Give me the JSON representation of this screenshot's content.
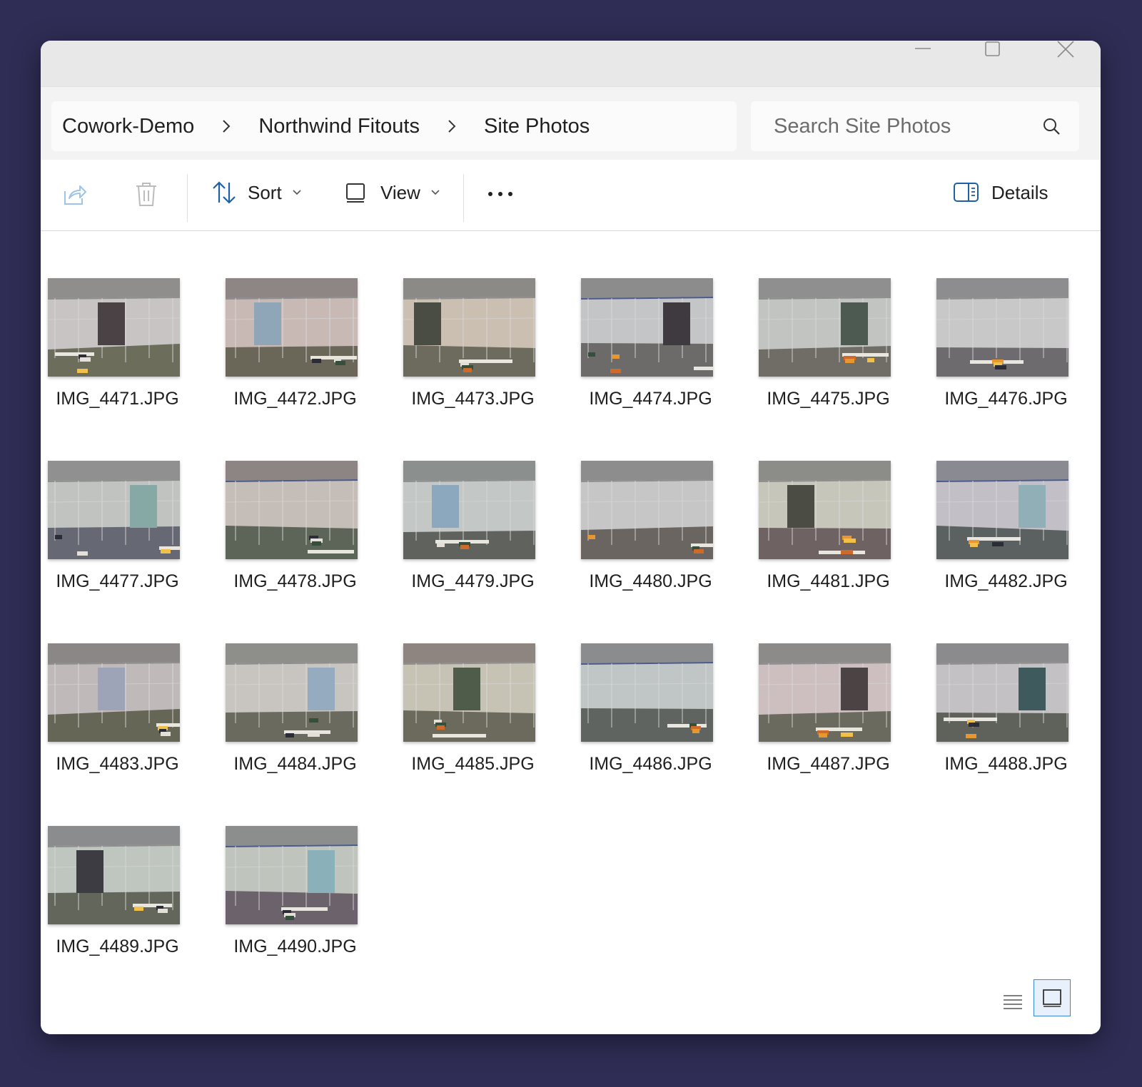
{
  "window": {
    "controls": [
      "minimize",
      "maximize",
      "close"
    ]
  },
  "breadcrumb": {
    "items": [
      "Cowork-Demo",
      "Northwind Fitouts",
      "Site Photos"
    ]
  },
  "search": {
    "placeholder": "Search Site Photos",
    "icon": "search-icon"
  },
  "toolbar": {
    "share_icon": "share-icon",
    "delete_icon": "trash-icon",
    "sort_label": "Sort",
    "view_label": "View",
    "more_icon": "more-icon",
    "details_label": "Details"
  },
  "files": [
    {
      "name": "IMG_4471.JPG",
      "sky": "#8f8e8c",
      "wall": "#c7c4c3",
      "floor": "#6c6d5a",
      "door": "#4a4244",
      "door_pos": "center",
      "hue": "neutral"
    },
    {
      "name": "IMG_4472.JPG",
      "sky": "#8d8684",
      "wall": "#c8b9b5",
      "floor": "#6a6658",
      "door": "#8ea6b7",
      "door_pos": "left",
      "hue": "pink"
    },
    {
      "name": "IMG_4473.JPG",
      "sky": "#8c8a86",
      "wall": "#cbbfb2",
      "floor": "#6d6a5e",
      "door": "#4a4d44",
      "door_pos": "farleft",
      "hue": "beige"
    },
    {
      "name": "IMG_4474.JPG",
      "sky": "#8c8c8c",
      "wall": "#c4c5c6",
      "floor": "#6d6a6a",
      "door": "#3e3a40",
      "door_pos": "right",
      "hue": "grey"
    },
    {
      "name": "IMG_4475.JPG",
      "sky": "#8f8f8f",
      "wall": "#c2c4c1",
      "floor": "#706c66",
      "door": "#4c5a52",
      "door_pos": "right",
      "hue": "grey"
    },
    {
      "name": "IMG_4476.JPG",
      "sky": "#8d8d8f",
      "wall": "#c8c8c9",
      "floor": "#6d6b6e",
      "door": "",
      "door_pos": "none",
      "hue": "grey"
    },
    {
      "name": "IMG_4477.JPG",
      "sky": "#8f908f",
      "wall": "#c1c3c1",
      "floor": "#666873",
      "door": "#87a9a6",
      "door_pos": "right",
      "hue": "grey"
    },
    {
      "name": "IMG_4478.JPG",
      "sky": "#8d8484",
      "wall": "#c5bdb8",
      "floor": "#5d6558",
      "door": "",
      "door_pos": "none",
      "hue": "pink"
    },
    {
      "name": "IMG_4479.JPG",
      "sky": "#8b8f8d",
      "wall": "#c3c7c6",
      "floor": "#5f625d",
      "door": "#8ba8bf",
      "door_pos": "left",
      "hue": "grey"
    },
    {
      "name": "IMG_4480.JPG",
      "sky": "#8e8d8e",
      "wall": "#c7c6c6",
      "floor": "#6b6561",
      "door": "",
      "door_pos": "none",
      "hue": "grey"
    },
    {
      "name": "IMG_4481.JPG",
      "sky": "#8c8d88",
      "wall": "#c6c7ba",
      "floor": "#6f6262",
      "door": "#4b4d44",
      "door_pos": "left",
      "hue": "green"
    },
    {
      "name": "IMG_4482.JPG",
      "sky": "#8a8a93",
      "wall": "#c3bfc7",
      "floor": "#5b6160",
      "door": "#90afb7",
      "door_pos": "right",
      "hue": "lilac"
    },
    {
      "name": "IMG_4483.JPG",
      "sky": "#8a8786",
      "wall": "#c0b9b9",
      "floor": "#656655",
      "door": "#9ea4b8",
      "door_pos": "center",
      "hue": "pink"
    },
    {
      "name": "IMG_4484.JPG",
      "sky": "#8e8e8b",
      "wall": "#c8c4bf",
      "floor": "#6b6a5e",
      "door": "#95abc0",
      "door_pos": "right",
      "hue": "beige"
    },
    {
      "name": "IMG_4485.JPG",
      "sky": "#8f8580",
      "wall": "#c7c3b4",
      "floor": "#6b6a5c",
      "door": "#4f5c49",
      "door_pos": "center",
      "hue": "beige"
    },
    {
      "name": "IMG_4486.JPG",
      "sky": "#8a8c8d",
      "wall": "#c0c6c6",
      "floor": "#5f6460",
      "door": "",
      "door_pos": "none",
      "hue": "grey"
    },
    {
      "name": "IMG_4487.JPG",
      "sky": "#8d8b8a",
      "wall": "#cdbfc0",
      "floor": "#6b6a5e",
      "door": "#4b4344",
      "door_pos": "right",
      "hue": "pink"
    },
    {
      "name": "IMG_4488.JPG",
      "sky": "#8b8a8c",
      "wall": "#c3c1c3",
      "floor": "#5f625a",
      "door": "#3f5a5c",
      "door_pos": "right",
      "hue": "grey"
    },
    {
      "name": "IMG_4489.JPG",
      "sky": "#8b8c8d",
      "wall": "#bfc6bf",
      "floor": "#63665b",
      "door": "#3d3c42",
      "door_pos": "left",
      "hue": "green"
    },
    {
      "name": "IMG_4490.JPG",
      "sky": "#8c8e8d",
      "wall": "#bfc4bd",
      "floor": "#6b626b",
      "door": "#8ab1ba",
      "door_pos": "right",
      "hue": "green"
    }
  ],
  "status_bar": {
    "list_view_icon": "list-view-icon",
    "grid_view_icon": "thumbnail-view-icon"
  }
}
